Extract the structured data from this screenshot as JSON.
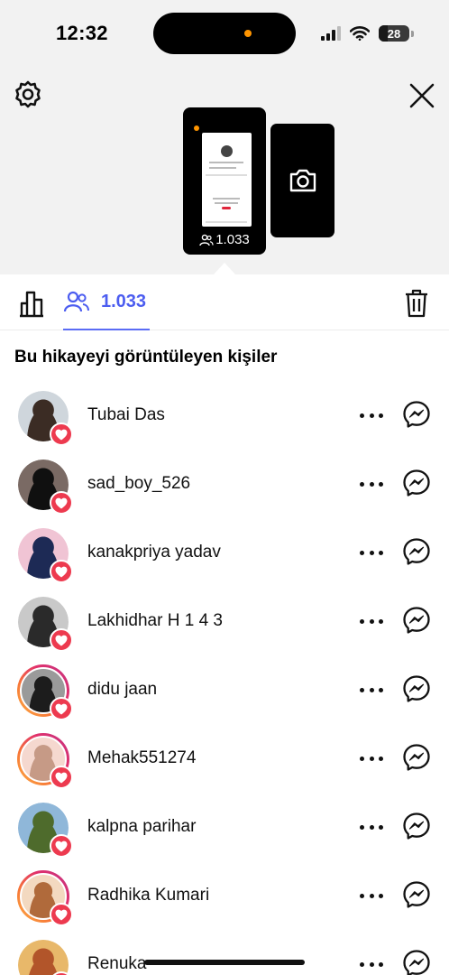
{
  "status_bar": {
    "time": "12:32",
    "battery_level": "28",
    "battery_fraction": 0.28,
    "indicator_color": "#ff9500"
  },
  "header": {
    "settings_icon": "gear-icon",
    "close_icon": "close-icon",
    "story_viewer_count": "1.033",
    "camera_icon": "camera-icon"
  },
  "tabs": {
    "insights_icon": "bar-chart-icon",
    "viewers_icon": "people-icon",
    "viewers_count": "1.033",
    "delete_icon": "trash-icon",
    "accent_color": "#4c5df0"
  },
  "section_title": "Bu hikayeyi görüntüleyen kişiler",
  "viewers": [
    {
      "name": "Tubai Das",
      "ring": false,
      "liked": true,
      "avatar_colors": [
        "#cfd6dc",
        "#3b2c24"
      ]
    },
    {
      "name": "sad_boy_526",
      "ring": false,
      "liked": true,
      "avatar_colors": [
        "#7a6a64",
        "#101010"
      ]
    },
    {
      "name": "kanakpriya yadav",
      "ring": false,
      "liked": true,
      "avatar_colors": [
        "#f0c4d4",
        "#1d2a55"
      ]
    },
    {
      "name": "Lakhidhar H 1 4 3",
      "ring": false,
      "liked": true,
      "avatar_colors": [
        "#c9c9c9",
        "#2a2a2a"
      ]
    },
    {
      "name": "didu jaan",
      "ring": true,
      "liked": true,
      "avatar_colors": [
        "#9a9a9a",
        "#1c1c1c"
      ]
    },
    {
      "name": "Mehak551274",
      "ring": true,
      "liked": true,
      "avatar_colors": [
        "#f5d8cf",
        "#c69a86"
      ]
    },
    {
      "name": "kalpna parihar",
      "ring": false,
      "liked": true,
      "avatar_colors": [
        "#8fb7d9",
        "#4e6b2c"
      ]
    },
    {
      "name": "Radhika Kumari",
      "ring": true,
      "liked": true,
      "avatar_colors": [
        "#f3d9c0",
        "#b06a3b"
      ]
    },
    {
      "name": "Renuka",
      "ring": false,
      "liked": true,
      "avatar_colors": [
        "#e8b86a",
        "#b2552a"
      ]
    }
  ],
  "row_actions": {
    "more_icon": "more-horizontal-icon",
    "message_icon": "messenger-icon",
    "heart_color": "#ed3a4f"
  }
}
